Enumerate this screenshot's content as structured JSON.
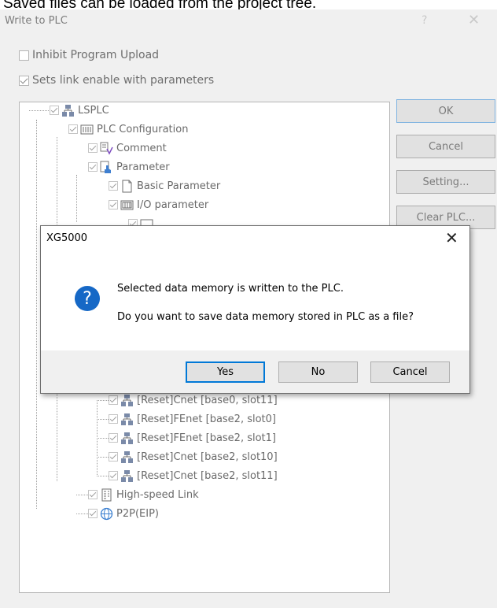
{
  "caption": "Saved files can be loaded from the project tree.",
  "window": {
    "title": "Write to PLC",
    "help_glyph": "?",
    "close_glyph": "✕"
  },
  "options": {
    "inhibit_upload": {
      "label": "Inhibit Program Upload",
      "checked": false
    },
    "link_enable": {
      "label": "Sets link enable with parameters",
      "checked": true
    }
  },
  "tree": {
    "root": "LSPLC",
    "plc_config": "PLC Configuration",
    "comment": "Comment",
    "parameter": "Parameter",
    "basic_parameter": "Basic Parameter",
    "io_parameter": "I/O parameter",
    "reset_items": [
      "[Reset]Cnet [base0, slot11]",
      "[Reset]FEnet [base2, slot0]",
      "[Reset]FEnet [base2, slot1]",
      "[Reset]Cnet [base2, slot10]",
      "[Reset]Cnet [base2, slot11]"
    ],
    "high_speed_link": "High-speed Link",
    "p2p": "P2P(EIP)"
  },
  "buttons": {
    "ok": "OK",
    "cancel": "Cancel",
    "setting": "Setting...",
    "clear_plc": "Clear PLC..."
  },
  "dialog": {
    "title": "XG5000",
    "close_glyph": "✕",
    "icon_glyph": "?",
    "message_line1": "Selected data memory is written to the PLC.",
    "message_line2": "Do you want to save data memory stored in PLC as a file?",
    "yes": "Yes",
    "no": "No",
    "cancel": "Cancel"
  },
  "colors": {
    "dialog_icon": "#1668c6",
    "focus_border": "#0078d7"
  }
}
